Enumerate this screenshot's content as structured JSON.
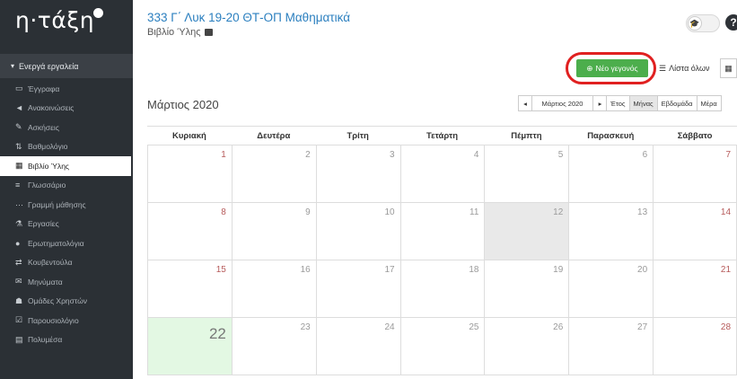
{
  "logo": {
    "text": "η·τάξη"
  },
  "sidebar": {
    "section_label": "Ενεργά εργαλεία",
    "items": [
      {
        "label": "Έγγραφα",
        "icon": "folder-icon",
        "glyph": "▭"
      },
      {
        "label": "Ανακοινώσεις",
        "icon": "bullhorn-icon",
        "glyph": "◄"
      },
      {
        "label": "Ασκήσεις",
        "icon": "edit-icon",
        "glyph": "✎"
      },
      {
        "label": "Βαθμολόγιο",
        "icon": "sort-icon",
        "glyph": "⇅"
      },
      {
        "label": "Βιβλίο Ύλης",
        "icon": "calendar-icon",
        "glyph": "▦",
        "active": true
      },
      {
        "label": "Γλωσσάριο",
        "icon": "list-icon",
        "glyph": "≡"
      },
      {
        "label": "Γραμμή μάθησης",
        "icon": "ellipsis-icon",
        "glyph": "···"
      },
      {
        "label": "Εργασίες",
        "icon": "flask-icon",
        "glyph": "⚗"
      },
      {
        "label": "Ερωτηματολόγια",
        "icon": "question-circle-icon",
        "glyph": "●"
      },
      {
        "label": "Κουβεντούλα",
        "icon": "exchange-icon",
        "glyph": "⇄"
      },
      {
        "label": "Μηνύματα",
        "icon": "envelope-icon",
        "glyph": "✉"
      },
      {
        "label": "Ομάδες Χρηστών",
        "icon": "users-icon",
        "glyph": "☗"
      },
      {
        "label": "Παρουσιολόγιο",
        "icon": "check-square-icon",
        "glyph": "☑"
      },
      {
        "label": "Πολυμέσα",
        "icon": "film-icon",
        "glyph": "▤"
      }
    ]
  },
  "header": {
    "course_title": "333 Γ΄ Λυκ 19-20 ΘΤ-ΟΠ Μαθηματικά",
    "subtitle": "Βιβλίο Ύλης"
  },
  "toolbar": {
    "new_event_label": "Νέο γεγονός",
    "list_all_label": "Λίστα όλων"
  },
  "calendar": {
    "month_title": "Μάρτιος 2020",
    "nav": {
      "prev": "◂",
      "current": "Μάρτιος 2020",
      "next": "▸"
    },
    "views": [
      {
        "label": "Έτος",
        "active": false
      },
      {
        "label": "Μήνας",
        "active": true
      },
      {
        "label": "Εβδομάδα",
        "active": false
      },
      {
        "label": "Μέρα",
        "active": false
      }
    ],
    "weekdays": [
      "Κυριακή",
      "Δευτέρα",
      "Τρίτη",
      "Τετάρτη",
      "Πέμπτη",
      "Παρασκευή",
      "Σάββατο"
    ],
    "weeks": [
      [
        "1",
        "2",
        "3",
        "4",
        "5",
        "6",
        "7"
      ],
      [
        "8",
        "9",
        "10",
        "11",
        "12",
        "13",
        "14"
      ],
      [
        "15",
        "16",
        "17",
        "18",
        "19",
        "20",
        "21"
      ],
      [
        "22",
        "23",
        "24",
        "25",
        "26",
        "27",
        "28"
      ]
    ],
    "highlight_day": "12",
    "today": "22"
  },
  "colors": {
    "sidebar_bg": "#2b3035",
    "accent_green": "#4cae4c",
    "title_blue": "#2b7fbf",
    "circle_red": "#e02020",
    "today_bg": "#e3f8e3"
  }
}
